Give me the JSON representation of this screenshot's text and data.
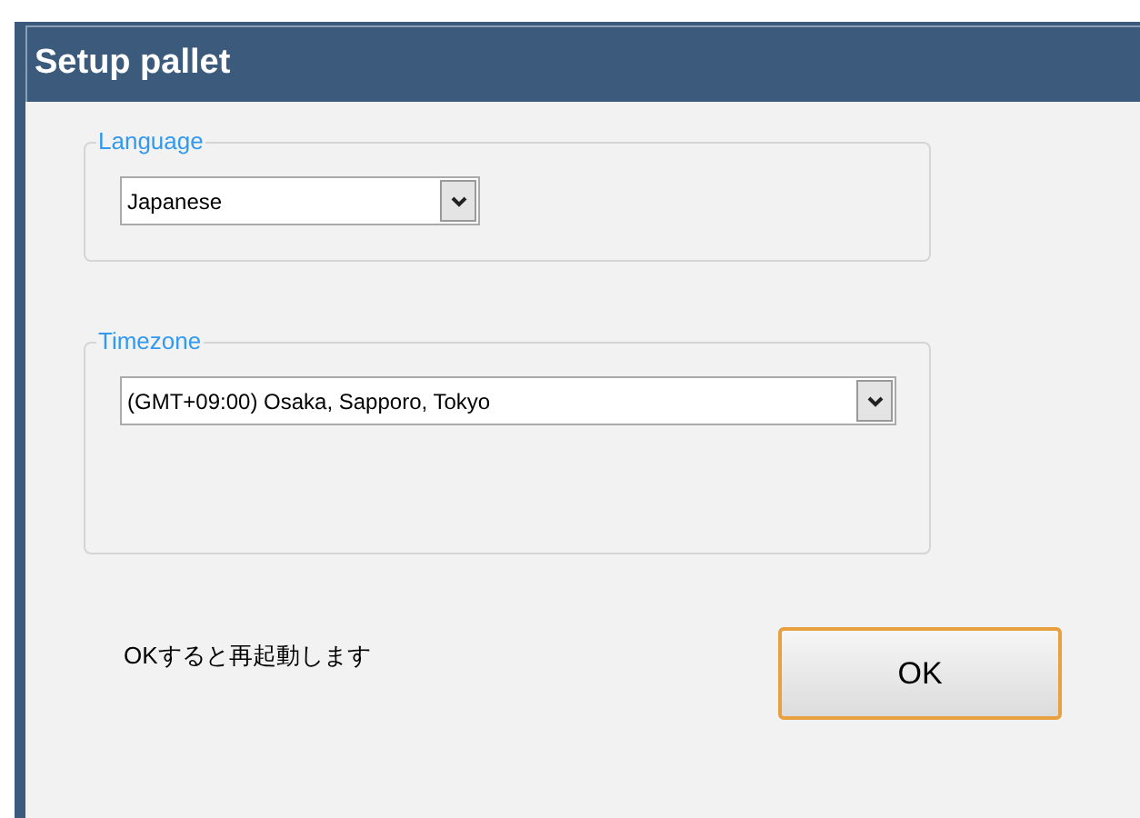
{
  "window": {
    "title": "Setup pallet"
  },
  "groups": [
    {
      "legend": "Language",
      "value": "Japanese"
    },
    {
      "legend": "Timezone",
      "value": "(GMT+09:00) Osaka, Sapporo, Tokyo"
    }
  ],
  "note": "OKすると再起動します",
  "buttons": [
    {
      "label": "OK",
      "focused": true
    }
  ]
}
